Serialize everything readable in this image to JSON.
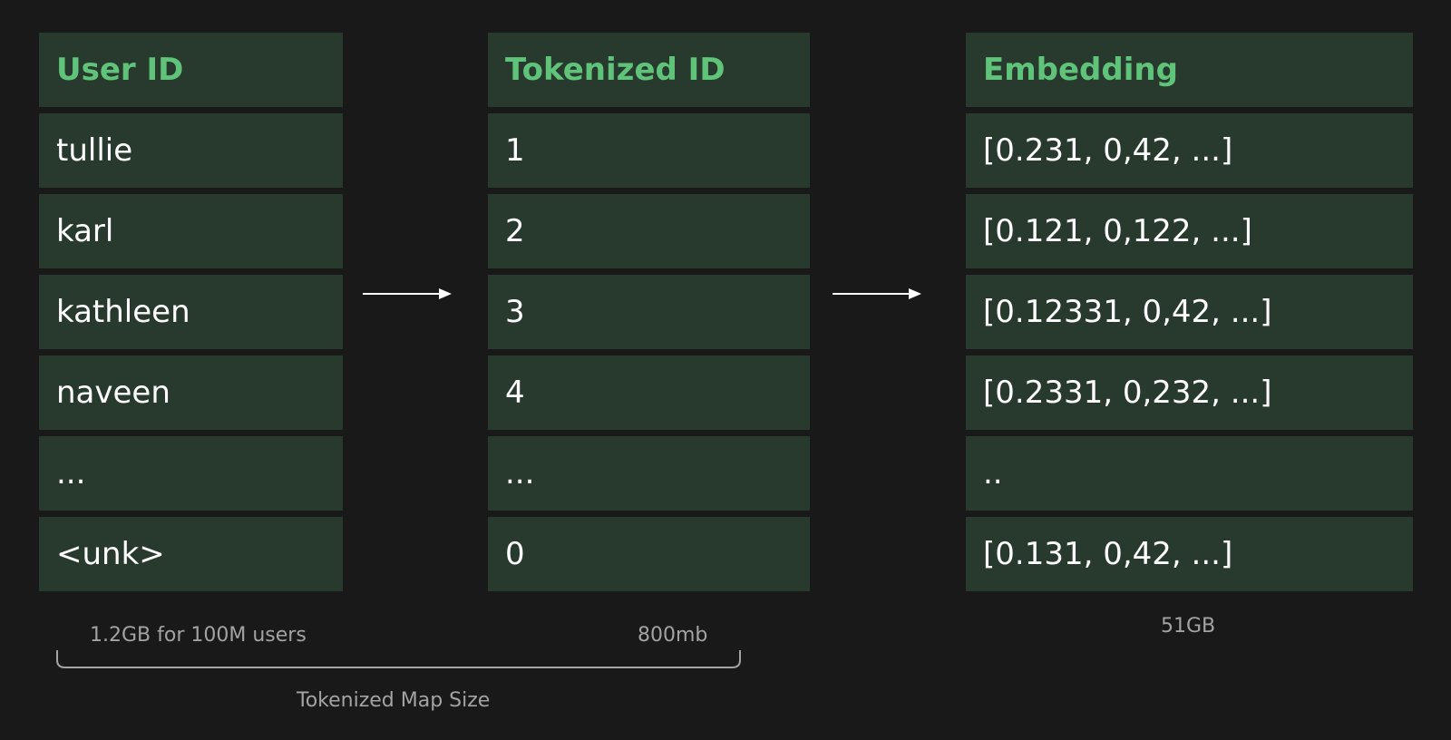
{
  "columns": {
    "user_id": {
      "header": "User ID",
      "rows": [
        "tullie",
        "karl",
        "kathleen",
        "naveen",
        "...",
        "<unk>"
      ]
    },
    "tokenized_id": {
      "header": "Tokenized ID",
      "rows": [
        "1",
        "2",
        "3",
        "4",
        "...",
        "0"
      ]
    },
    "embedding": {
      "header": "Embedding",
      "rows": [
        "[0.231, 0,42, ...]",
        "[0.121, 0,122, ...]",
        "[0.12331, 0,42, ...]",
        "[0.2331, 0,232, ...]",
        "..",
        "[0.131, 0,42, ...]"
      ]
    }
  },
  "sizes": {
    "user_map": "1.2GB for 100M users",
    "token_map": "800mb",
    "embedding": "51GB",
    "brace_label": "Tokenized Map Size"
  },
  "colors": {
    "background": "#191919",
    "cell": "#283a2e",
    "header_text": "#5fc47a",
    "cell_text": "#ffffff",
    "caption_text": "#a3a3a3",
    "arrow": "#ffffff"
  }
}
